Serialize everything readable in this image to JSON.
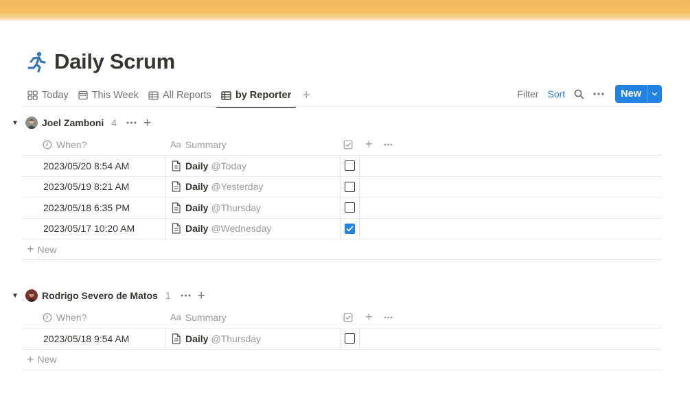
{
  "page": {
    "title": "Daily Scrum",
    "icon": "running-person-icon",
    "accent_color": "#2383e2",
    "cover_color": "#f2b85a"
  },
  "views": [
    {
      "label": "Today",
      "icon": "board-icon",
      "active": false
    },
    {
      "label": "This Week",
      "icon": "calendar-icon",
      "active": false
    },
    {
      "label": "All Reports",
      "icon": "table-icon",
      "active": false
    },
    {
      "label": "by Reporter",
      "icon": "table-icon",
      "active": true
    }
  ],
  "toolbar": {
    "filter_label": "Filter",
    "sort_label": "Sort",
    "new_label": "New"
  },
  "columns": {
    "when": "When?",
    "summary": "Summary",
    "aa": "Aa"
  },
  "groups": [
    {
      "name": "Joel Zamboni",
      "count": "4",
      "rows": [
        {
          "when": "2023/05/20 8:54 AM",
          "title": "Daily",
          "mention": "@Today",
          "checked": false
        },
        {
          "when": "2023/05/19 8:21 AM",
          "title": "Daily",
          "mention": "@Yesterday",
          "checked": false
        },
        {
          "when": "2023/05/18 6:35 PM",
          "title": "Daily",
          "mention": "@Thursday",
          "checked": false
        },
        {
          "when": "2023/05/17 10:20 AM",
          "title": "Daily",
          "mention": "@Wednesday",
          "checked": true
        }
      ],
      "new_label": "New"
    },
    {
      "name": "Rodrigo Severo de Matos",
      "count": "1",
      "rows": [
        {
          "when": "2023/05/18 9:54 AM",
          "title": "Daily",
          "mention": "@Thursday",
          "checked": false
        }
      ],
      "new_label": "New"
    }
  ]
}
